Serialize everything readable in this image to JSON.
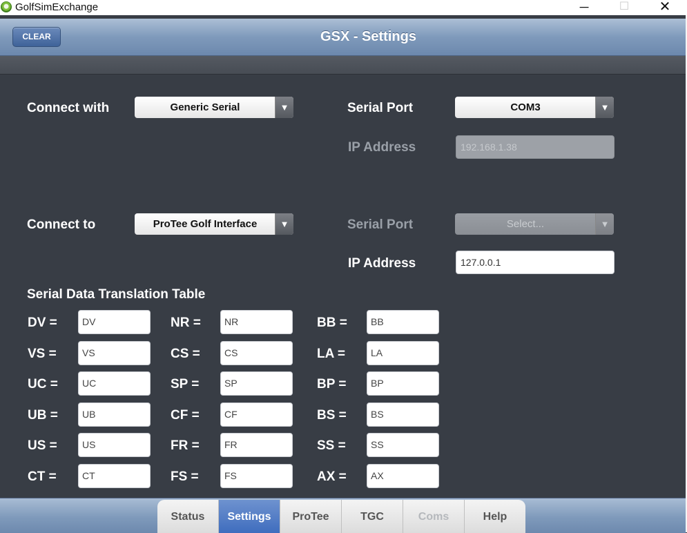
{
  "window": {
    "title": "GolfSimExchange",
    "minimize_glyph": "─",
    "maximize_glyph": "☐",
    "close_glyph": "✕"
  },
  "header": {
    "title": "GSX - Settings",
    "clear_label": "CLEAR"
  },
  "connect_with": {
    "label": "Connect with",
    "selected": "Generic Serial",
    "serial_port_label": "Serial Port",
    "serial_port_selected": "COM3",
    "ip_label": "IP Address",
    "ip_value": "192.168.1.38",
    "ip_disabled": true
  },
  "connect_to": {
    "label": "Connect to",
    "selected": "ProTee Golf Interface",
    "serial_port_label": "Serial Port",
    "serial_port_selected": "Select...",
    "serial_port_disabled": true,
    "ip_label": "IP Address",
    "ip_value": "127.0.0.1"
  },
  "dropdown_arrow_glyph": "▼",
  "translation_table": {
    "title": "Serial Data Translation Table",
    "columns": [
      [
        {
          "code": "DV =",
          "value": "DV"
        },
        {
          "code": "VS =",
          "value": "VS"
        },
        {
          "code": "UC =",
          "value": "UC"
        },
        {
          "code": "UB =",
          "value": "UB"
        },
        {
          "code": "US =",
          "value": "US"
        },
        {
          "code": "CT =",
          "value": "CT"
        }
      ],
      [
        {
          "code": "NR =",
          "value": "NR"
        },
        {
          "code": "CS =",
          "value": "CS"
        },
        {
          "code": "SP =",
          "value": "SP"
        },
        {
          "code": "CF =",
          "value": "CF"
        },
        {
          "code": "FR =",
          "value": "FR"
        },
        {
          "code": "FS =",
          "value": "FS"
        }
      ],
      [
        {
          "code": "BB =",
          "value": "BB"
        },
        {
          "code": "LA =",
          "value": "LA"
        },
        {
          "code": "BP =",
          "value": "BP"
        },
        {
          "code": "BS =",
          "value": "BS"
        },
        {
          "code": "SS =",
          "value": "SS"
        },
        {
          "code": "AX =",
          "value": "AX"
        }
      ]
    ]
  },
  "tabs": [
    {
      "label": "Status",
      "state": "normal"
    },
    {
      "label": "Settings",
      "state": "active"
    },
    {
      "label": "ProTee",
      "state": "normal"
    },
    {
      "label": "TGC",
      "state": "normal"
    },
    {
      "label": "Coms",
      "state": "disabled"
    },
    {
      "label": "Help",
      "state": "normal"
    }
  ],
  "colors": {
    "background": "#383d45",
    "header_blue": "#7f9abb",
    "active_tab": "#4a74c2",
    "disabled_text": "#9aa0a8"
  }
}
